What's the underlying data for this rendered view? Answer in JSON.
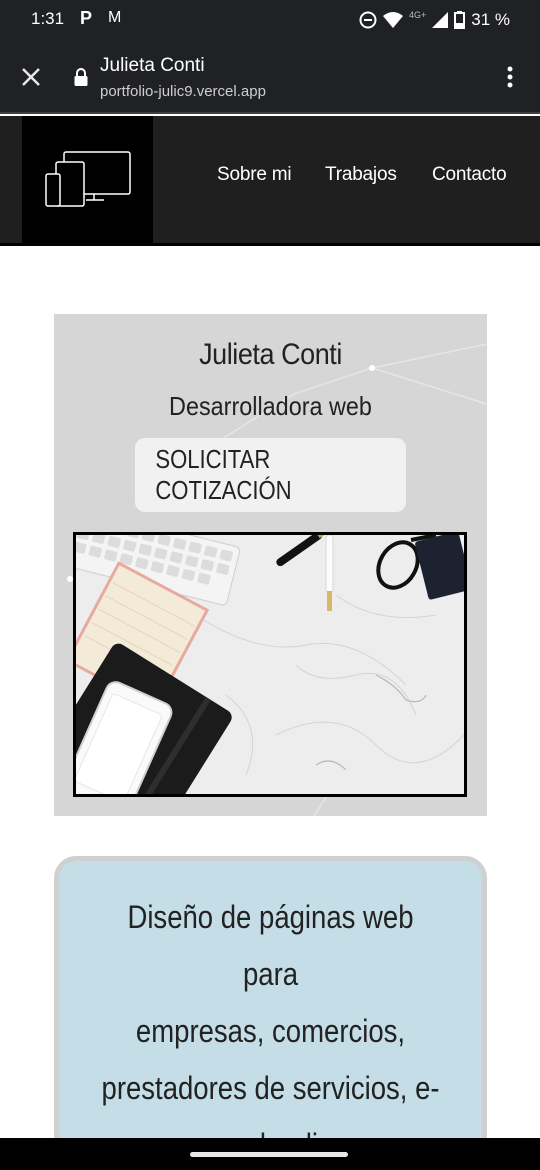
{
  "status_bar": {
    "time": "1:31",
    "app_icon_p": "P",
    "app_icon_m": "M",
    "network": "4G+",
    "battery": "31 %",
    "icons": [
      "dnd-icon",
      "wifi-icon",
      "signal-icon",
      "battery-icon"
    ]
  },
  "browser": {
    "title": "Julieta Conti",
    "url": "portfolio-julic9.vercel.app",
    "icons": [
      "close-icon",
      "lock-icon",
      "more-vert-icon"
    ]
  },
  "nav": {
    "items": [
      "Sobre mi",
      "Trabajos",
      "Contacto"
    ],
    "logo_icon": "devices-icon"
  },
  "hero": {
    "name": "Julieta Conti",
    "role": "Desarrolladora web",
    "cta_label": "SOLICITAR COTIZACIÓN",
    "image_icon": "desk-workspace-image"
  },
  "service": {
    "lines": [
      "Diseño de páginas web para",
      "empresas, comercios,",
      "prestadores de servicios, e-",
      "commerce, landing page."
    ]
  },
  "colors": {
    "browser_bg": "#202124",
    "header_bg": "#1f1f1f",
    "hero_bg": "#d6d6d6",
    "service_bg": "#c5dde6"
  }
}
